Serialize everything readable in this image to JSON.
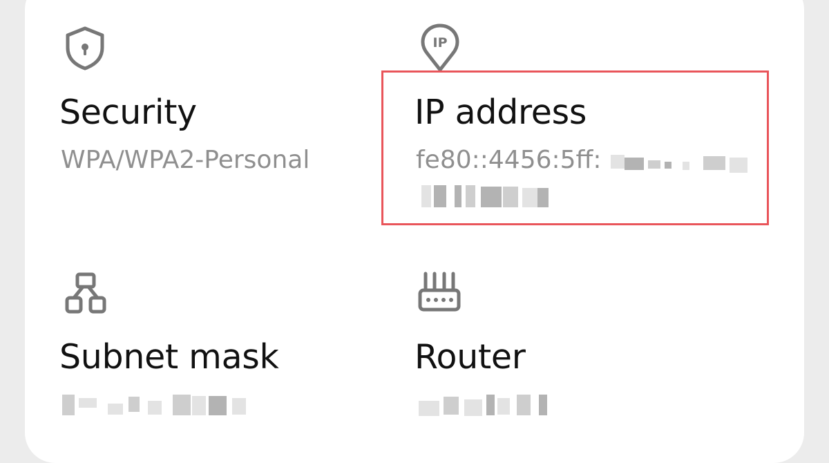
{
  "items": [
    {
      "key": "security",
      "label": "Security",
      "value": "WPA/WPA2-Personal",
      "icon": "shield-icon"
    },
    {
      "key": "ip",
      "label": "IP address",
      "value_visible": "fe80::4456:5ff:",
      "icon": "ip-location-pin-icon",
      "icon_text": "IP",
      "highlighted": true
    },
    {
      "key": "subnet",
      "label": "Subnet mask",
      "icon": "network-topology-icon"
    },
    {
      "key": "router",
      "label": "Router",
      "icon": "router-icon"
    }
  ],
  "colors": {
    "background": "#ececec",
    "card": "#ffffff",
    "label": "#111111",
    "value": "#8f8f8f",
    "icon": "#777777",
    "highlight": "#e9555a"
  }
}
